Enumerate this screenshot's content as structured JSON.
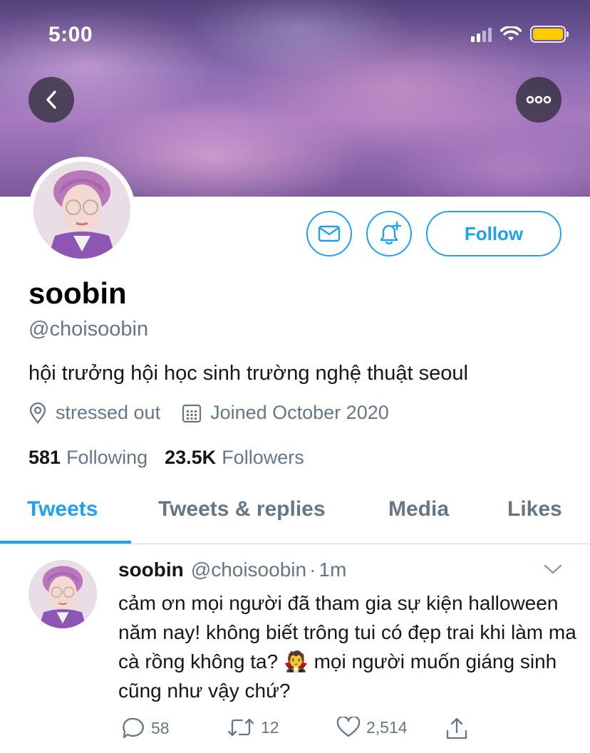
{
  "status_bar": {
    "time": "5:00"
  },
  "profile": {
    "display_name": "soobin",
    "handle": "@choisoobin",
    "bio": "hội trưởng hội học sinh trường nghệ thuật seoul",
    "location": "stressed out",
    "joined": "Joined October 2020",
    "following_count": "581",
    "following_label": "Following",
    "followers_count": "23.5K",
    "followers_label": "Followers",
    "follow_button_label": "Follow"
  },
  "tabs": [
    {
      "label": "Tweets",
      "active": true
    },
    {
      "label": "Tweets & replies",
      "active": false
    },
    {
      "label": "Media",
      "active": false
    },
    {
      "label": "Likes",
      "active": false
    }
  ],
  "tweet": {
    "name": "soobin",
    "handle": "@choisoobin",
    "separator": "·",
    "time": "1m",
    "text": "cảm ơn mọi người đã tham gia sự kiện halloween năm nay! không biết trông tui có đẹp trai khi làm ma cà rồng không ta? 🧛 mọi người muốn giáng sinh cũng như vậy chứ?",
    "replies": "58",
    "retweets": "12",
    "likes": "2,514"
  },
  "colors": {
    "accent": "#1da1f2",
    "secondary_text": "#657786",
    "battery": "#ffcc00"
  },
  "icons": [
    "back-arrow-icon",
    "more-options-icon",
    "mail-icon",
    "bell-plus-icon",
    "location-pin-icon",
    "calendar-icon",
    "chevron-down-icon",
    "reply-icon",
    "retweet-icon",
    "heart-icon",
    "share-icon",
    "cellular-signal-icon",
    "wifi-icon",
    "battery-icon"
  ]
}
